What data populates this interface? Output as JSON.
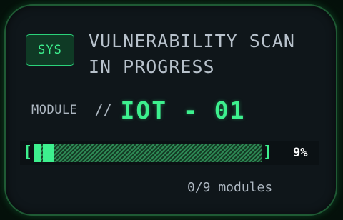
{
  "badge": {
    "label": "SYS"
  },
  "title": {
    "line1": "VULNERABILITY SCAN",
    "line2": "IN PROGRESS"
  },
  "module": {
    "label": "MODULE",
    "separator": "//",
    "id": "IOT - 01"
  },
  "progress": {
    "bracket_left": "[",
    "bracket_right": "]",
    "percent_value": 9,
    "percent_label": "9%",
    "modules_text": "0/9 modules"
  },
  "colors": {
    "accent": "#3df08e",
    "accent_dim": "#2e8a55",
    "card_bg": "#0f161a",
    "border": "#1f5a34",
    "text_muted": "#aeb8c2",
    "percent_text": "#ffffff"
  }
}
